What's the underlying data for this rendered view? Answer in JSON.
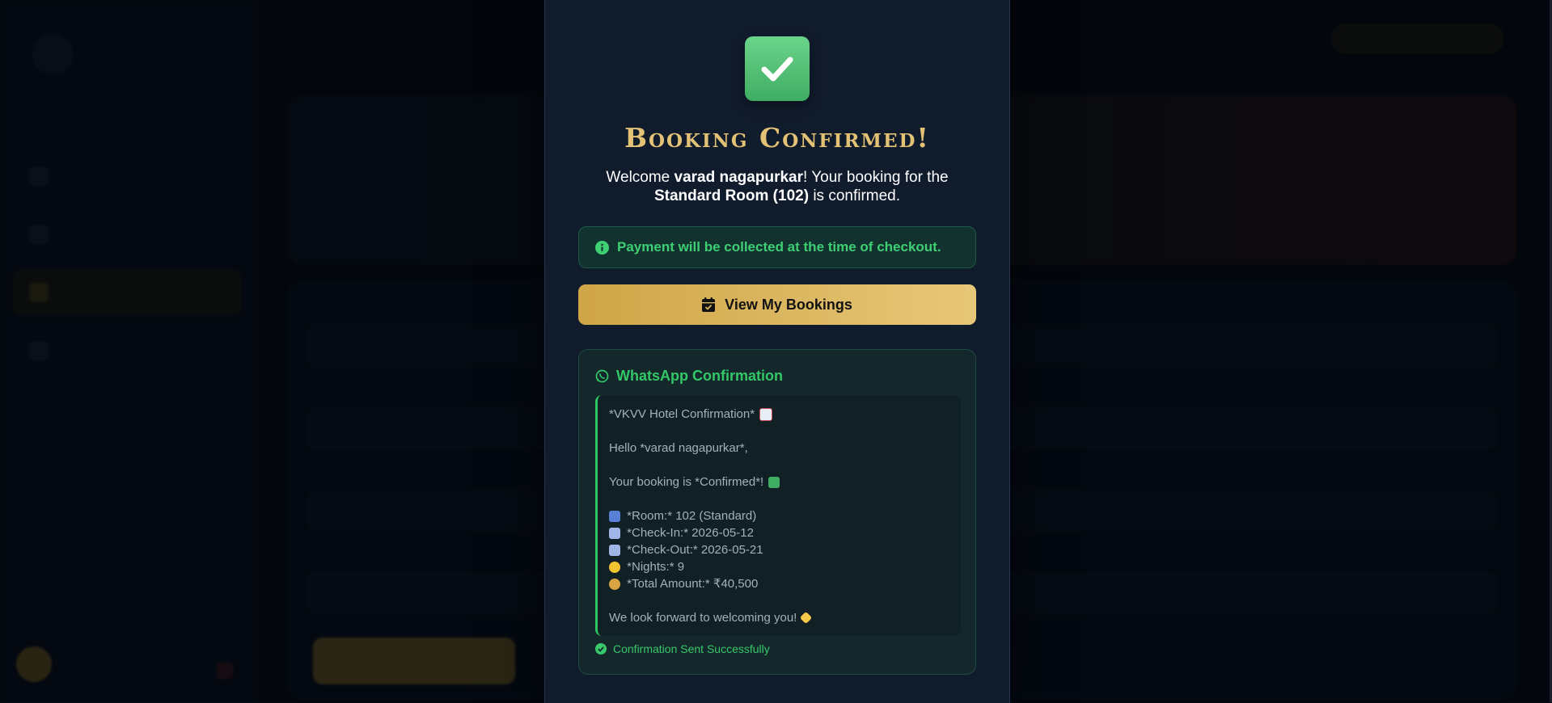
{
  "modal": {
    "title": "Booking Confirmed!",
    "welcome_prefix": "Welcome ",
    "guest_name": "varad nagapurkar",
    "welcome_mid": "! Your booking for the",
    "room_label": "Standard Room (102)",
    "welcome_suffix": " is confirmed.",
    "payment_notice": "Payment will be collected at the time of checkout.",
    "view_bookings_label": "View My Bookings",
    "whatsapp": {
      "heading": "WhatsApp Confirmation",
      "line_title": "*VKVV Hotel Confirmation*",
      "line_hello": "Hello *varad nagapurkar*,",
      "line_status": "Your booking is *Confirmed*!",
      "line_room": "*Room:* 102 (Standard)",
      "line_checkin": "*Check-In:* 2026-05-12",
      "line_checkout": "*Check-Out:* 2026-05-21",
      "line_nights": "*Nights:* 9",
      "line_total": "*Total Amount:* ₹40,500",
      "line_closing": "We look forward to welcoming you!",
      "status": "Confirmation Sent Successfully"
    }
  },
  "colors": {
    "accent_gold": "#e3c275",
    "success_green": "#3ecf73",
    "modal_bg": "#101b2c"
  },
  "icons": {
    "check": "check-square-icon",
    "info": "info-circle-icon",
    "calendar": "calendar-check-icon",
    "whatsapp": "whatsapp-icon",
    "sent": "check-circle-icon"
  }
}
